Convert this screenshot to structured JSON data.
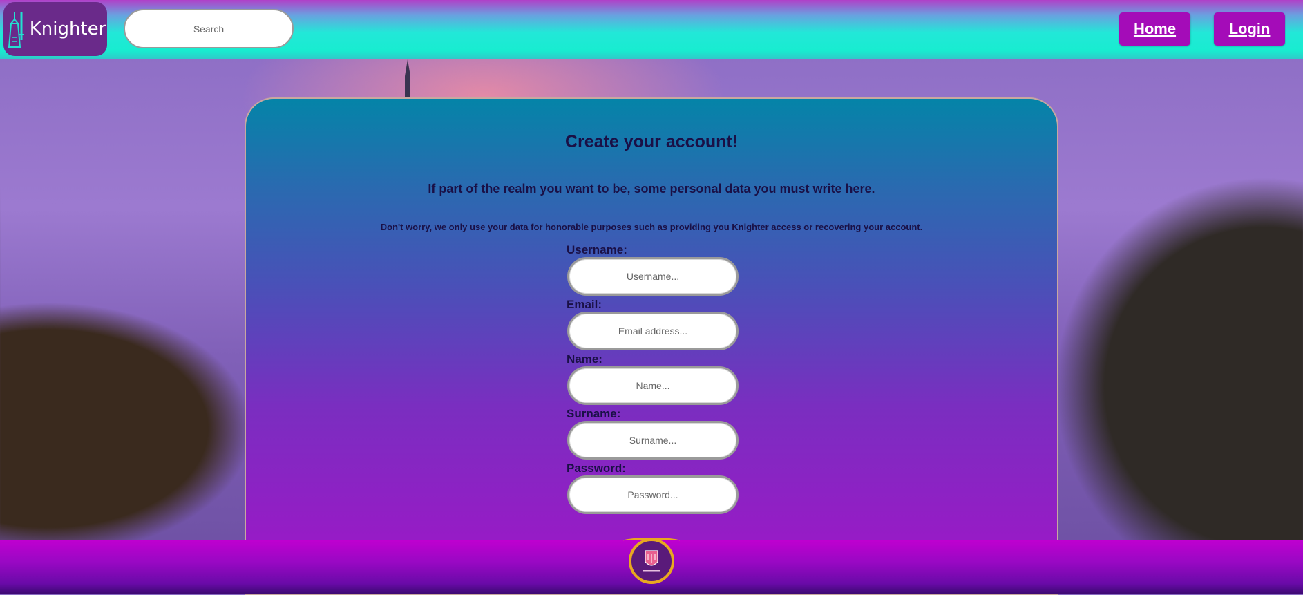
{
  "header": {
    "logo_text": "Knighter",
    "search_placeholder": "Search",
    "nav": {
      "home": "Home",
      "login": "Login"
    }
  },
  "register": {
    "title": "Create your account!",
    "subtitle": "If part of the realm you want to be, some personal data you must write here.",
    "note": "Don't worry, we only use your data for honorable purposes such as providing you Knighter access or recovering your account.",
    "fields": [
      {
        "label": "Username:",
        "placeholder": "Username..."
      },
      {
        "label": "Email:",
        "placeholder": "Email address..."
      },
      {
        "label": "Name:",
        "placeholder": "Name..."
      },
      {
        "label": "Surname:",
        "placeholder": "Surname..."
      },
      {
        "label": "Password:",
        "placeholder": "Password..."
      }
    ]
  },
  "colors": {
    "nav_button": "#a40cb8",
    "card_top": "#0484a8",
    "card_bottom": "#a214c8",
    "text_dark": "#1a1046"
  },
  "icons": {
    "logo": "knight-tower-sword-icon",
    "footer_badge": "crest-badge-icon"
  }
}
